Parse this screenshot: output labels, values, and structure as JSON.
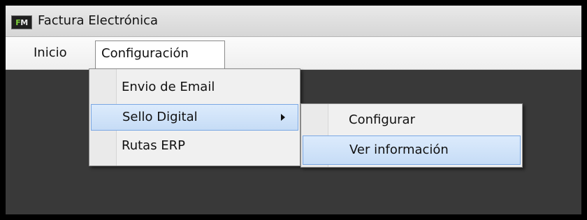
{
  "window": {
    "title": "Factura Electrónica",
    "icon_letters": {
      "f": "F",
      "m": "M"
    },
    "icon_name": "app-logo-icon"
  },
  "menubar": {
    "items": [
      {
        "label": "Inicio"
      },
      {
        "label": "Configuración",
        "active": true
      }
    ]
  },
  "dropdown": {
    "items": [
      {
        "label": "Envio de Email"
      },
      {
        "label": "Sello Digital",
        "submenu": true,
        "highlighted": true
      },
      {
        "label": "Rutas ERP"
      }
    ]
  },
  "submenu": {
    "items": [
      {
        "label": "Configurar"
      },
      {
        "label": "Ver información",
        "highlighted": true
      }
    ]
  },
  "colors": {
    "client_background": "#393939",
    "highlight_border": "#7aa7e3",
    "logo_f": "#7fd23a"
  }
}
